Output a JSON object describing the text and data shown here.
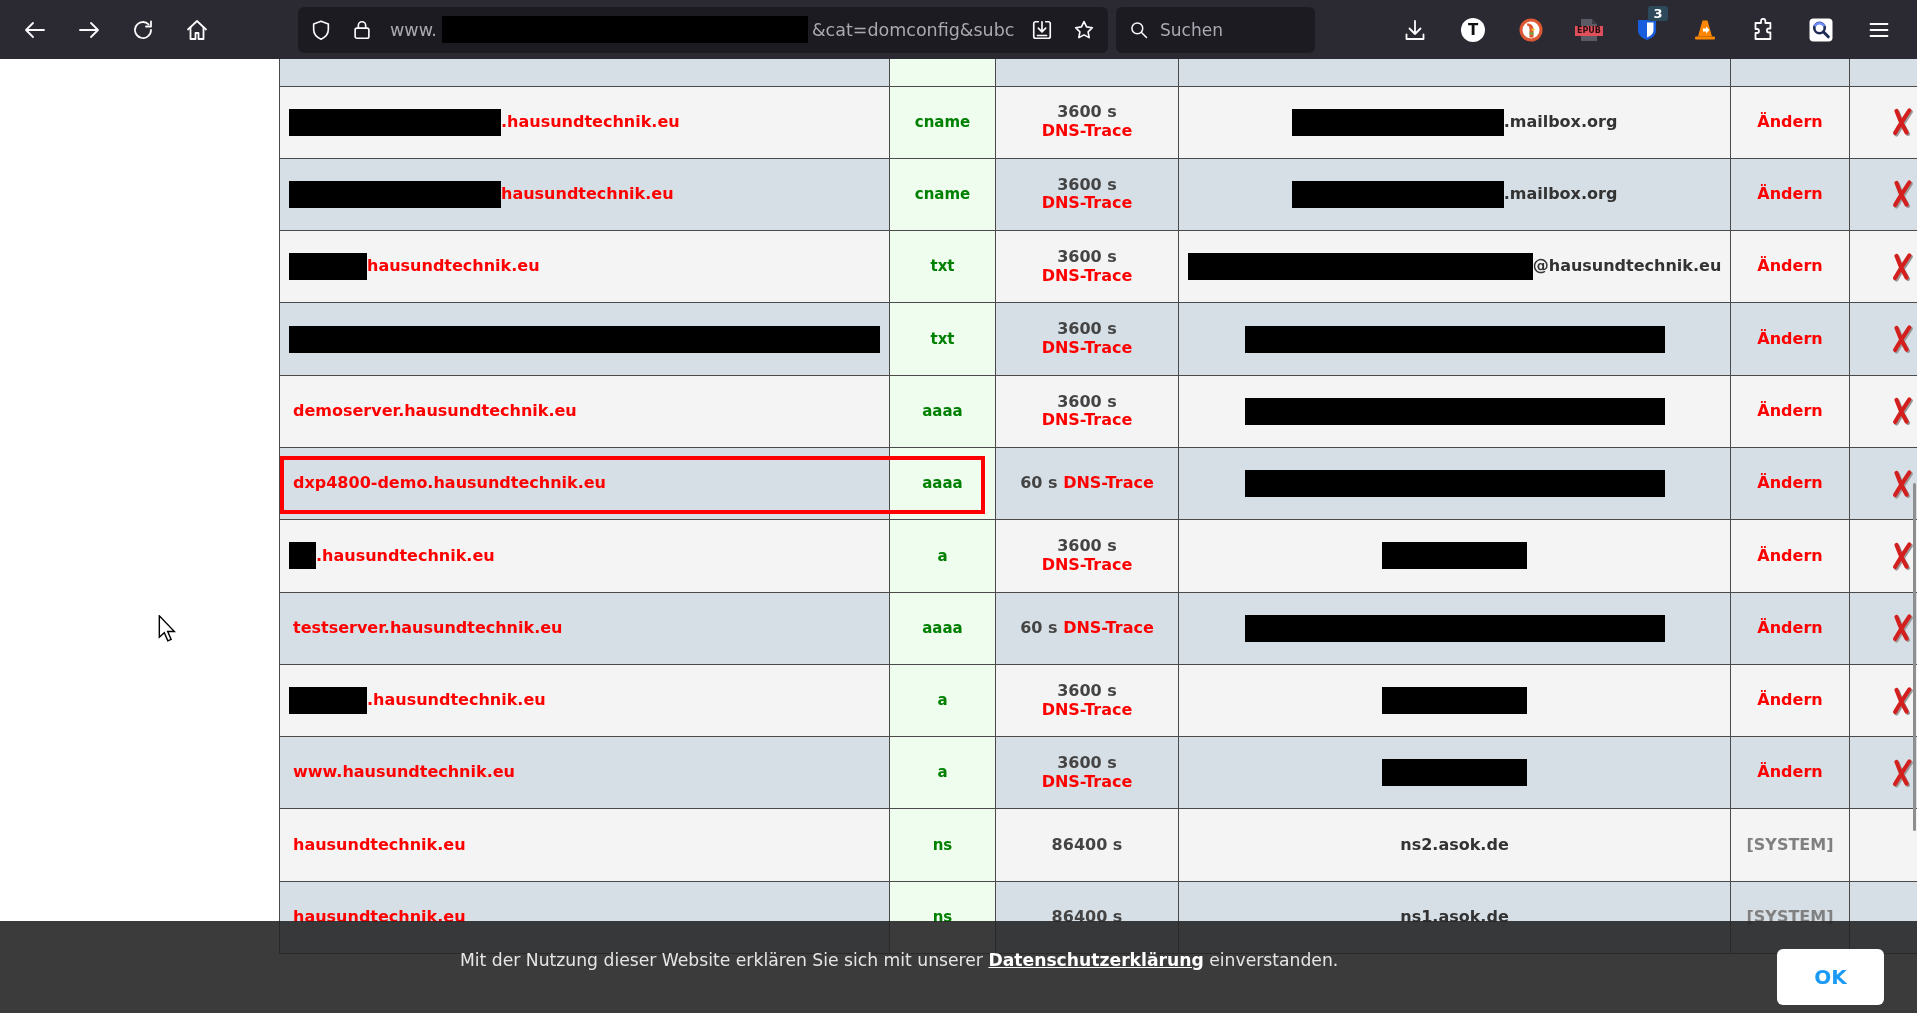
{
  "browser": {
    "address_bar": {
      "prefix": "www.",
      "redacted": true,
      "suffix": "&cat=domconfig&subc"
    },
    "search": {
      "placeholder": "Suchen"
    },
    "toolbar": {
      "extension_letter": "T",
      "file_label": "EPUB",
      "extension_badge": "3"
    }
  },
  "table": {
    "rows": [
      {
        "name": {
          "kind": "longmask",
          "text": ".hausundtechnik.eu"
        },
        "type": "cname",
        "ttl": "3600 s",
        "trace_link": "DNS-Trace",
        "value": {
          "kind": "longmask",
          "text": ".mailbox.org"
        },
        "action": {
          "kind": "link",
          "text": "Ändern"
        },
        "deletable": true,
        "highlighted": false
      },
      {
        "name": {
          "kind": "longmask",
          "text": "hausundtechnik.eu"
        },
        "type": "cname",
        "ttl": "3600 s",
        "trace_link": "DNS-Trace",
        "value": {
          "kind": "longmask",
          "text": ".mailbox.org"
        },
        "action": {
          "kind": "link",
          "text": "Ändern"
        },
        "deletable": true,
        "highlighted": false
      },
      {
        "name": {
          "kind": "shortmask",
          "text": "hausundtechnik.eu"
        },
        "type": "txt",
        "ttl": "3600 s",
        "trace_link": "DNS-Trace",
        "value": {
          "kind": "widemask",
          "text": "@hausundtechnik.eu"
        },
        "action": {
          "kind": "link",
          "text": "Ändern"
        },
        "deletable": true,
        "highlighted": false
      },
      {
        "name": {
          "kind": "fullmask"
        },
        "type": "txt",
        "ttl": "3600 s",
        "trace_link": "DNS-Trace",
        "value": {
          "kind": "widermask"
        },
        "action": {
          "kind": "link",
          "text": "Ändern"
        },
        "deletable": true,
        "highlighted": false
      },
      {
        "name": {
          "kind": "plain",
          "text": "demoserver.hausundtechnik.eu"
        },
        "type": "aaaa",
        "ttl": "3600 s",
        "trace_link": "DNS-Trace",
        "value": {
          "kind": "widermask"
        },
        "action": {
          "kind": "link",
          "text": "Ändern"
        },
        "deletable": true,
        "highlighted": false
      },
      {
        "name": {
          "kind": "plain",
          "text": "dxp4800-demo.hausundtechnik.eu"
        },
        "type": "aaaa",
        "ttl": "60 s",
        "trace_link": "DNS-Trace",
        "value": {
          "kind": "widermask"
        },
        "action": {
          "kind": "link",
          "text": "Ändern"
        },
        "deletable": true,
        "highlighted": true
      },
      {
        "name": {
          "kind": "tinymask",
          "text": ".hausundtechnik.eu"
        },
        "type": "a",
        "ttl": "3600 s",
        "trace_link": "DNS-Trace",
        "value": {
          "kind": "mediummask"
        },
        "action": {
          "kind": "link",
          "text": "Ändern"
        },
        "deletable": true,
        "highlighted": false
      },
      {
        "name": {
          "kind": "plain",
          "text": "testserver.hausundtechnik.eu"
        },
        "type": "aaaa",
        "ttl": "60 s",
        "trace_link": "DNS-Trace",
        "value": {
          "kind": "widermask"
        },
        "action": {
          "kind": "link",
          "text": "Ändern"
        },
        "deletable": true,
        "highlighted": false
      },
      {
        "name": {
          "kind": "shortmask",
          "text": ".hausundtechnik.eu"
        },
        "type": "a",
        "ttl": "3600 s",
        "trace_link": "DNS-Trace",
        "value": {
          "kind": "mediummask"
        },
        "action": {
          "kind": "link",
          "text": "Ändern"
        },
        "deletable": true,
        "highlighted": false
      },
      {
        "name": {
          "kind": "plain",
          "text": "www.hausundtechnik.eu"
        },
        "type": "a",
        "ttl": "3600 s",
        "trace_link": "DNS-Trace",
        "value": {
          "kind": "mediummask"
        },
        "action": {
          "kind": "link",
          "text": "Ändern"
        },
        "deletable": true,
        "highlighted": false
      },
      {
        "name": {
          "kind": "plain",
          "text": "hausundtechnik.eu"
        },
        "type": "ns",
        "ttl": "86400 s",
        "value": {
          "kind": "plain",
          "text": "ns2.asok.de"
        },
        "action": {
          "kind": "system",
          "text": "[SYSTEM]"
        },
        "deletable": false,
        "highlighted": false
      },
      {
        "name": {
          "kind": "plain",
          "text": "hausundtechnik.eu"
        },
        "type": "ns",
        "ttl": "86400 s",
        "value": {
          "kind": "plain",
          "text": "ns1.asok.de"
        },
        "action": {
          "kind": "system",
          "text": "[SYSTEM]"
        },
        "deletable": false,
        "highlighted": false
      }
    ]
  },
  "cookie_banner": {
    "text_before": "Mit der Nutzung dieser Website erklären Sie sich mit unserer",
    "link": "Datenschutzerklärung",
    "text_after": "einverstanden.",
    "button": "OK"
  }
}
